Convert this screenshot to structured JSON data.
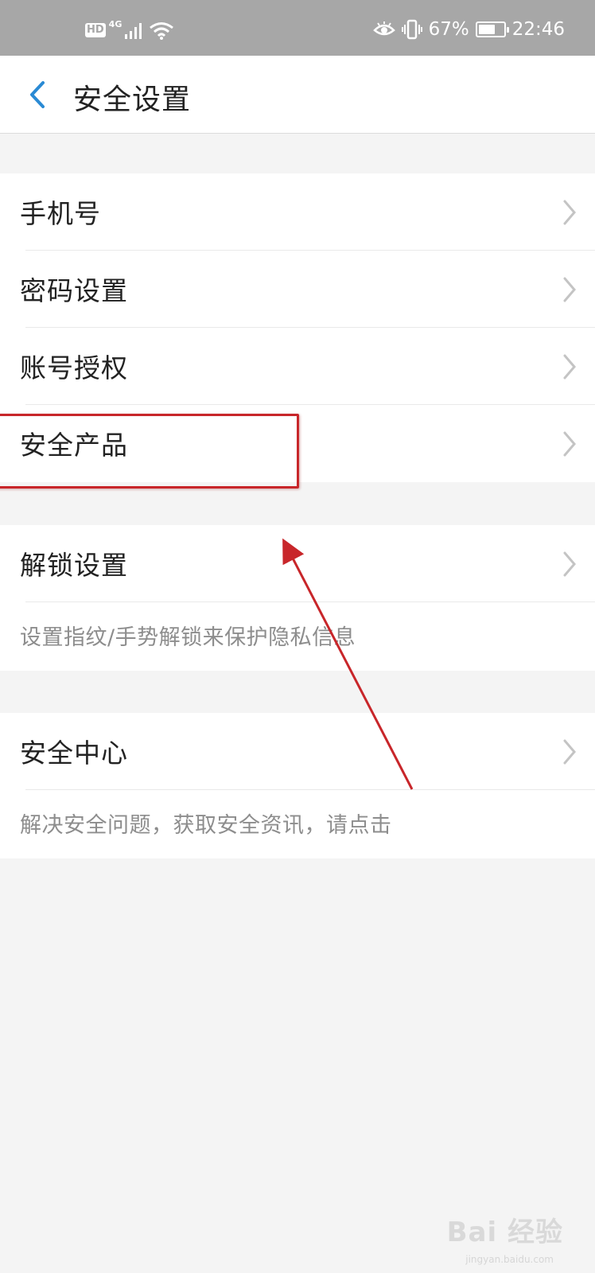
{
  "status_bar": {
    "hd": "HD",
    "network": "4G",
    "battery_percent": "67%",
    "battery_level": 0.67,
    "time": "22:46",
    "icons": [
      "hd-icon",
      "signal-icon",
      "wifi-icon",
      "eye-icon",
      "vibrate-icon",
      "battery-icon"
    ]
  },
  "header": {
    "title": "安全设置",
    "back_icon": "chevron-left-icon",
    "accent_color": "#2a8ad4"
  },
  "groups": [
    {
      "items": [
        {
          "label": "手机号"
        },
        {
          "label": "密码设置"
        },
        {
          "label": "账号授权"
        },
        {
          "label": "安全产品"
        }
      ]
    },
    {
      "items": [
        {
          "label": "解锁设置"
        }
      ],
      "hint": "设置指纹/手势解锁来保护隐私信息"
    },
    {
      "items": [
        {
          "label": "安全中心"
        }
      ],
      "hint": "解决安全问题，获取安全资讯，请点击"
    }
  ],
  "annotation": {
    "highlighted_item": "安全产品",
    "color": "#c8262a"
  },
  "watermark": {
    "text": "Bai 经验",
    "sub": "jingyan.baidu.com"
  }
}
